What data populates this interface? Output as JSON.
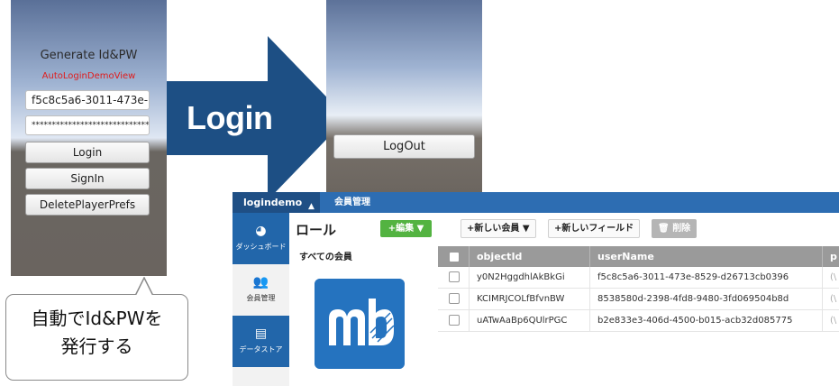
{
  "left_screen": {
    "title": "Generate Id&PW",
    "subtitle": "AutoLoginDemoView",
    "id_value": "f5c8c5a6-3011-473e-",
    "pw_value": "*****************************",
    "buttons": [
      "Login",
      "SignIn",
      "DeletePlayerPrefs"
    ]
  },
  "arrow_label": "Login",
  "bubble_lines": [
    "自動でId&PWを",
    "発行する"
  ],
  "right_screen": {
    "logout_label": "LogOut"
  },
  "dashboard": {
    "app_name": "logindemo",
    "breadcrumb": "会員管理",
    "sidebar": [
      {
        "label": "ダッシュボード",
        "icon": "gauge-icon"
      },
      {
        "label": "会員管理",
        "icon": "users-icon"
      },
      {
        "label": "データストア",
        "icon": "database-icon"
      }
    ],
    "role_title": "ロール",
    "edit_button": "+編集 ▼",
    "all_members": "すべての会員",
    "toolbar": {
      "new_member": "+新しい会員 ▼",
      "new_field": "+新しいフィールド",
      "delete": "削除"
    },
    "columns": [
      "objectId",
      "userName",
      "p"
    ],
    "rows": [
      {
        "objectId": "y0N2HggdhlAkBkGi",
        "userName": "f5c8c5a6-3011-473e-8529-d26713cb0396",
        "p": "(\\"
      },
      {
        "objectId": "KCIMRJCOLfBfvnBW",
        "userName": "8538580d-2398-4fd8-9480-3fd069504b8d",
        "p": "(\\"
      },
      {
        "objectId": "uATwAaBp6QUlrPGC",
        "userName": "b2e833e3-406d-4500-b015-acb32d085775",
        "p": "(\\"
      }
    ]
  },
  "colors": {
    "arrow": "#1d4f84",
    "topbar": "#2d6db2",
    "edit_green": "#53b341",
    "logo_blue": "#2573bf",
    "subtitle_red": "#e01c1c"
  }
}
